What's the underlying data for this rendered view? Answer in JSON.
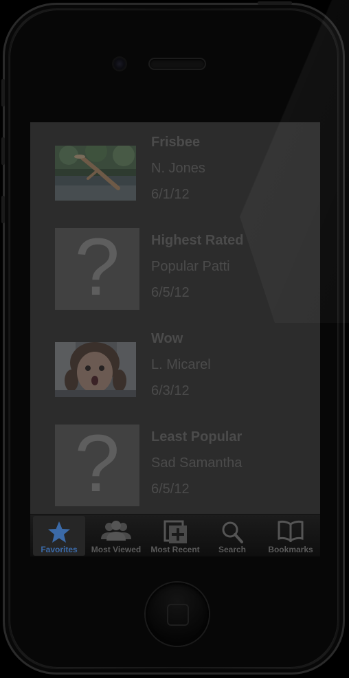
{
  "videos": [
    {
      "title": "Frisbee",
      "author": "N. Jones",
      "date": "6/1/12",
      "thumbnail": "frisbee-dog-photo"
    },
    {
      "title": "Highest Rated",
      "author": "Popular Patti",
      "date": "6/5/12",
      "thumbnail": "placeholder-question"
    },
    {
      "title": "Wow",
      "author": "L. Micarel",
      "date": "6/3/12",
      "thumbnail": "girl-surprised-photo"
    },
    {
      "title": "Least Popular",
      "author": "Sad Samantha",
      "date": "6/5/12",
      "thumbnail": "placeholder-question"
    }
  ],
  "placeholder_glyph": "?",
  "tabs": [
    {
      "label": "Favorites",
      "icon": "star-icon",
      "active": true
    },
    {
      "label": "Most Viewed",
      "icon": "people-icon",
      "active": false
    },
    {
      "label": "Most Recent",
      "icon": "add-document-icon",
      "active": false
    },
    {
      "label": "Search",
      "icon": "search-icon",
      "active": false
    },
    {
      "label": "Bookmarks",
      "icon": "book-icon",
      "active": false
    }
  ],
  "colors": {
    "active_tab": "#3b6aa8",
    "list_text": "#4b4b4b",
    "screen_bg": "#2c2c2c"
  }
}
